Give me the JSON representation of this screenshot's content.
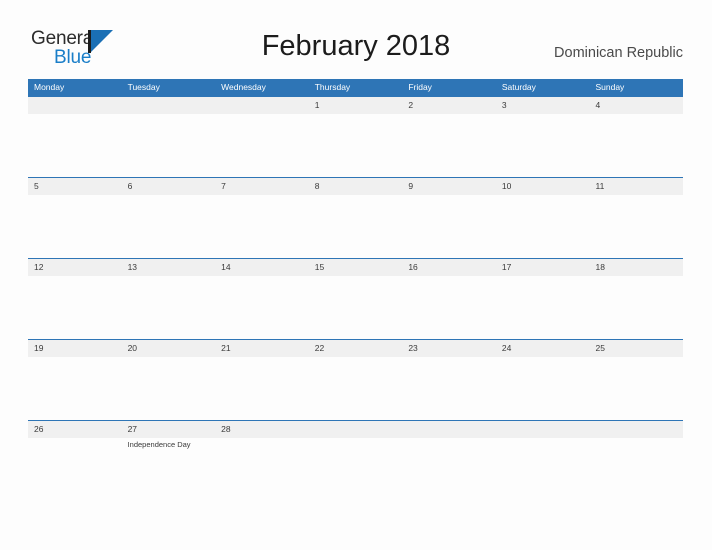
{
  "branding": {
    "logo_primary": "General",
    "logo_secondary": "Blue",
    "logo_flag_icon": "flag-triangle-icon",
    "accent_blue": "#1a7ec8"
  },
  "header": {
    "title": "February 2018",
    "region": "Dominican Republic"
  },
  "calendar": {
    "header_bg": "#2e75b6",
    "number_band_bg": "#f0f0f0",
    "weekdays": [
      "Monday",
      "Tuesday",
      "Wednesday",
      "Thursday",
      "Friday",
      "Saturday",
      "Sunday"
    ],
    "weeks": [
      {
        "days": [
          {
            "number": "",
            "event": ""
          },
          {
            "number": "",
            "event": ""
          },
          {
            "number": "",
            "event": ""
          },
          {
            "number": "1",
            "event": ""
          },
          {
            "number": "2",
            "event": ""
          },
          {
            "number": "3",
            "event": ""
          },
          {
            "number": "4",
            "event": ""
          }
        ]
      },
      {
        "days": [
          {
            "number": "5",
            "event": ""
          },
          {
            "number": "6",
            "event": ""
          },
          {
            "number": "7",
            "event": ""
          },
          {
            "number": "8",
            "event": ""
          },
          {
            "number": "9",
            "event": ""
          },
          {
            "number": "10",
            "event": ""
          },
          {
            "number": "11",
            "event": ""
          }
        ]
      },
      {
        "days": [
          {
            "number": "12",
            "event": ""
          },
          {
            "number": "13",
            "event": ""
          },
          {
            "number": "14",
            "event": ""
          },
          {
            "number": "15",
            "event": ""
          },
          {
            "number": "16",
            "event": ""
          },
          {
            "number": "17",
            "event": ""
          },
          {
            "number": "18",
            "event": ""
          }
        ]
      },
      {
        "days": [
          {
            "number": "19",
            "event": ""
          },
          {
            "number": "20",
            "event": ""
          },
          {
            "number": "21",
            "event": ""
          },
          {
            "number": "22",
            "event": ""
          },
          {
            "number": "23",
            "event": ""
          },
          {
            "number": "24",
            "event": ""
          },
          {
            "number": "25",
            "event": ""
          }
        ]
      },
      {
        "days": [
          {
            "number": "26",
            "event": ""
          },
          {
            "number": "27",
            "event": "Independence Day"
          },
          {
            "number": "28",
            "event": ""
          },
          {
            "number": "",
            "event": ""
          },
          {
            "number": "",
            "event": ""
          },
          {
            "number": "",
            "event": ""
          },
          {
            "number": "",
            "event": ""
          }
        ]
      }
    ]
  }
}
